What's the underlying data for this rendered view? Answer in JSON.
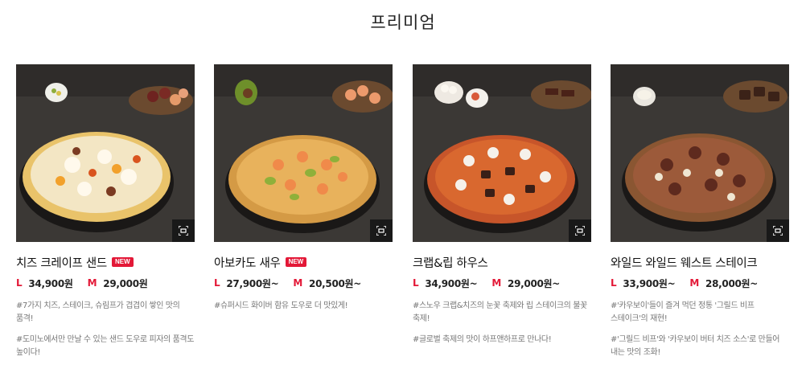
{
  "section": {
    "title": "프리미엄"
  },
  "menus": [
    {
      "name": "치즈 크레이프 샌드",
      "badge": "NEW",
      "size_l": "L",
      "price_l": "34,900원",
      "size_m": "M",
      "price_m": "29,000원",
      "desc": [
        "#7가지 치즈, 스테이크, 슈림프가 겹겹이 쌓인 맛의 품격!",
        "#도미노에서만 만날 수 있는 샌드 도우로 피자의 품격도 높이다!"
      ]
    },
    {
      "name": "아보카도 새우",
      "badge": "NEW",
      "size_l": "L",
      "price_l": "27,900원~",
      "size_m": "M",
      "price_m": "20,500원~",
      "desc": [
        "#슈퍼시드 화이버 함유 도우로 더 맛있게!"
      ]
    },
    {
      "name": "크랩&립 하우스",
      "badge": "",
      "size_l": "L",
      "price_l": "34,900원~",
      "size_m": "M",
      "price_m": "29,000원~",
      "desc": [
        "#스노우 크랩&치즈의 눈꽃 축제와 립 스테이크의 불꽃 축제!",
        "#글로벌 축제의 맛이 하프앤하프로 만나다!"
      ]
    },
    {
      "name": "와일드 와일드 웨스트 스테이크",
      "badge": "",
      "size_l": "L",
      "price_l": "33,900원~",
      "size_m": "M",
      "price_m": "28,000원~",
      "desc": [
        "#'카우보이'들이 즐겨 먹던 정통 '그릴드 비프 스테이크'의 재현!",
        "#'그릴드 비프'와 '카우보이 버터 치즈 소스'로 만들어 내는 맛의 조화!"
      ]
    }
  ]
}
